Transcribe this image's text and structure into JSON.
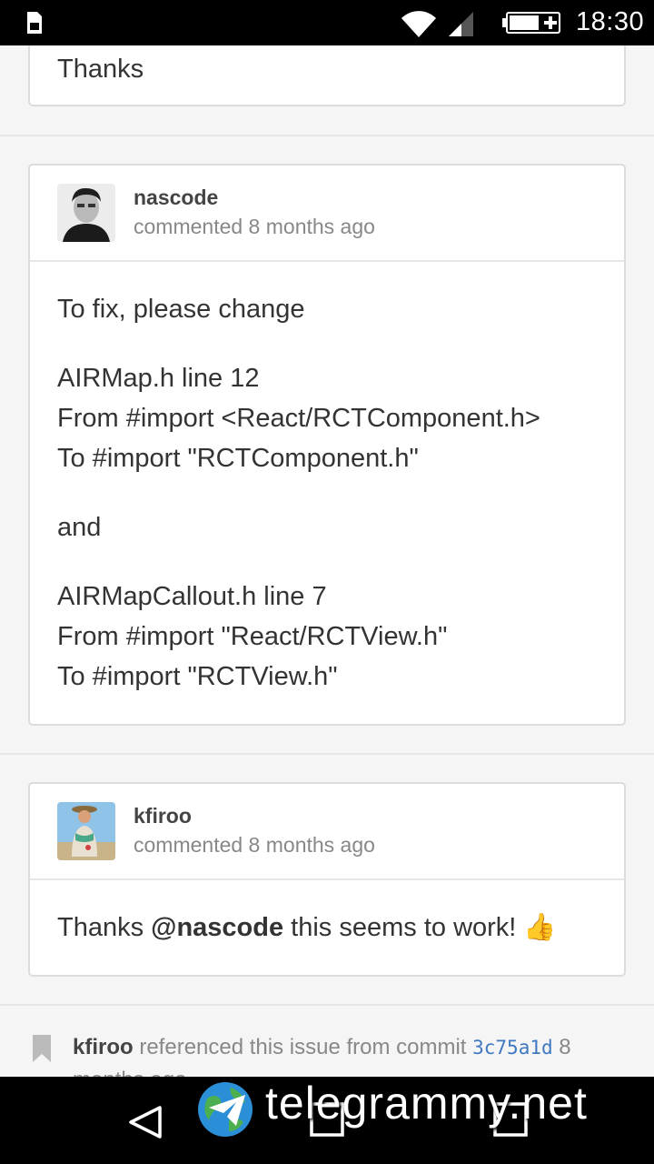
{
  "status_bar": {
    "time": "18:30"
  },
  "previous_comment": {
    "body": "Thanks"
  },
  "comments": [
    {
      "author": "nascode",
      "meta": "commented 8 months ago",
      "lines": {
        "p1": "To fix, please change",
        "p2a": "AIRMap.h line 12",
        "p2b": "From #import <React/RCTComponent.h>",
        "p2c": "To #import \"RCTComponent.h\"",
        "p3": "and",
        "p4a": "AIRMapCallout.h line 7",
        "p4b": "From #import \"React/RCTView.h\"",
        "p4c": "To #import \"RCTView.h\""
      }
    },
    {
      "author": "kfiroo",
      "meta": "commented 8 months ago",
      "body_prefix": "Thanks ",
      "mention": "@nascode",
      "body_suffix": " this seems to work! ",
      "emoji": "👍"
    }
  ],
  "reference": {
    "user": "kfiroo",
    "action": " referenced this issue from commit ",
    "commit": "3c75a1d",
    "time": " 8",
    "time_continued": "months ago"
  },
  "watermark": {
    "text": "telegrammy.net"
  }
}
